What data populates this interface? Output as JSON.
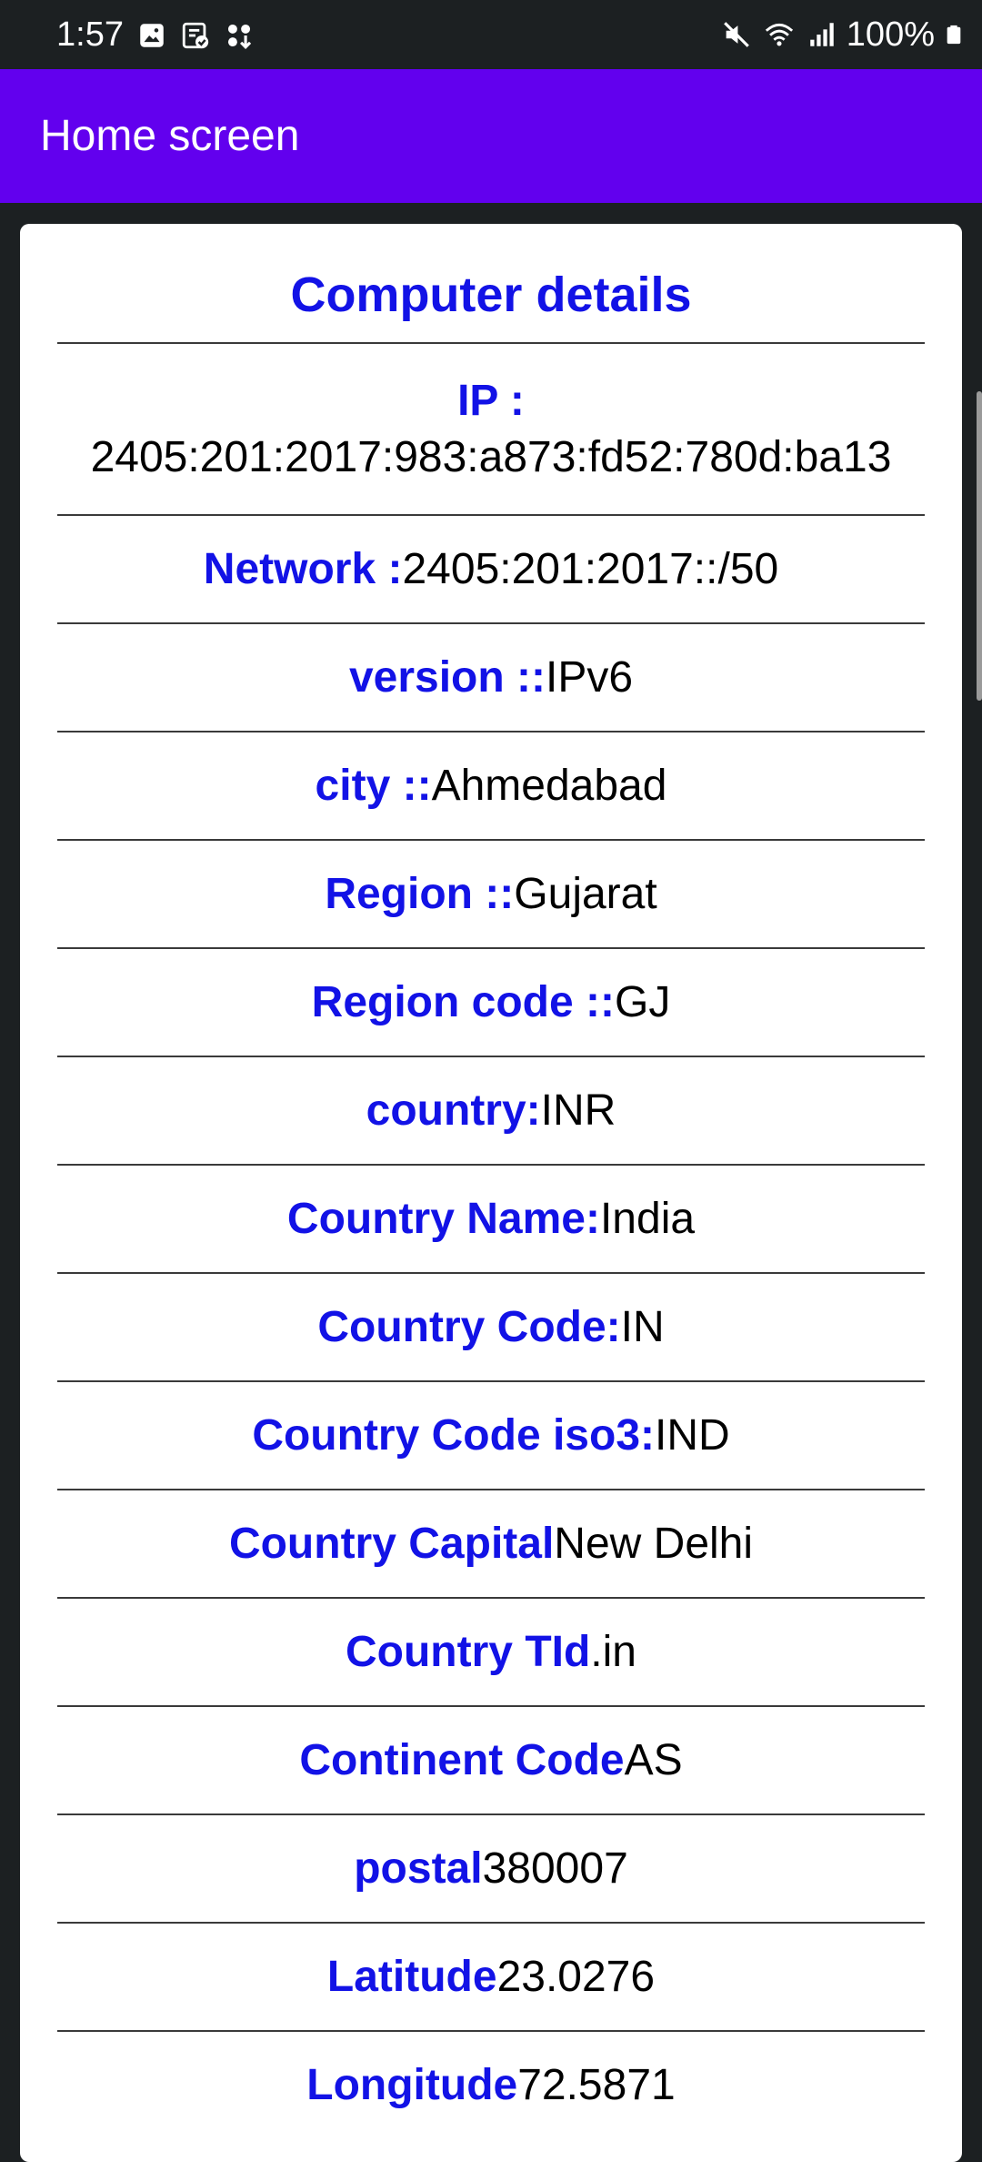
{
  "status_bar": {
    "time": "1:57",
    "battery": "100%"
  },
  "app_bar": {
    "title": "Home screen"
  },
  "card": {
    "title": "Computer details",
    "rows": [
      {
        "label": "IP : ",
        "value": "2405:201:2017:983:a873:fd52:780d:ba13"
      },
      {
        "label": "Network :",
        "value": "2405:201:2017::/50"
      },
      {
        "label": "version ::",
        "value": "IPv6"
      },
      {
        "label": "city ::",
        "value": "Ahmedabad"
      },
      {
        "label": "Region ::",
        "value": "Gujarat"
      },
      {
        "label": "Region code ::",
        "value": "GJ"
      },
      {
        "label": "country:",
        "value": "INR"
      },
      {
        "label": "Country Name:",
        "value": "India"
      },
      {
        "label": "Country Code:",
        "value": "IN"
      },
      {
        "label": "Country Code iso3:",
        "value": "IND"
      },
      {
        "label": "Country Capital",
        "value": "New Delhi"
      },
      {
        "label": "Country TId",
        "value": ".in"
      },
      {
        "label": "Continent Code",
        "value": "AS"
      },
      {
        "label": "postal",
        "value": "380007"
      },
      {
        "label": "Latitude",
        "value": "23.0276"
      },
      {
        "label": "Longitude",
        "value": "72.5871"
      }
    ]
  },
  "colors": {
    "app_bar": "#6200ee",
    "label": "#1212e6",
    "background": "#1c2022"
  }
}
